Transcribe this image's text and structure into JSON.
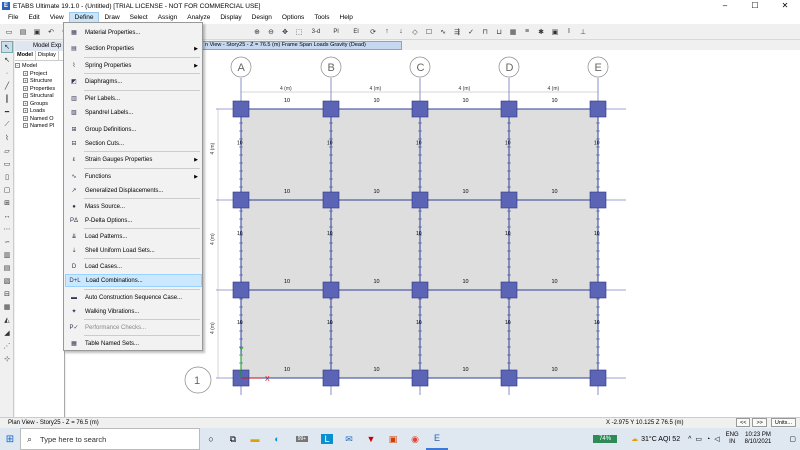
{
  "window": {
    "title": "ETABS Ultimate 19.1.0 - (Untitled)  [TRIAL LICENSE - NOT FOR COMMERCIAL USE]",
    "app_icon_letter": "E",
    "minimize": "–",
    "maximize": "☐",
    "close": "✕"
  },
  "menubar": [
    "File",
    "Edit",
    "View",
    "Define",
    "Draw",
    "Select",
    "Assign",
    "Analyze",
    "Display",
    "Design",
    "Options",
    "Tools",
    "Help"
  ],
  "active_menu": "Define",
  "toolbar": {
    "view_3d": "3-d",
    "view_plan": "Pl",
    "view_elev": "El"
  },
  "explorer": {
    "title": "Model Exp",
    "tabs": [
      "Model",
      "Display"
    ],
    "tree": [
      "Model",
      "Project",
      "Structure",
      "Properties",
      "Structural",
      "Groups",
      "Loads",
      "Named O",
      "Named Pl"
    ]
  },
  "view_tab": "n View - Story25 - Z = 76.5 (m)  Frame Span Loads Gravity (Dead)",
  "define_menu": [
    {
      "label": "Material Properties...",
      "icon": "material-icon",
      "glyph": "▦",
      "submenu": false,
      "enabled": true
    },
    {
      "label": "Section Properties",
      "icon": "section-icon",
      "glyph": "▤",
      "submenu": true,
      "enabled": true
    },
    {
      "label": "Spring Properties",
      "icon": "spring-icon",
      "glyph": "⌇",
      "submenu": true,
      "enabled": true
    },
    {
      "label": "Diaphragms...",
      "icon": "diaphragm-icon",
      "glyph": "◩",
      "submenu": false,
      "enabled": true
    },
    {
      "label": "Pier Labels...",
      "icon": "pier-icon",
      "glyph": "▥",
      "submenu": false,
      "enabled": true
    },
    {
      "label": "Spandrel Labels...",
      "icon": "spandrel-icon",
      "glyph": "▧",
      "submenu": false,
      "enabled": true
    },
    {
      "label": "Group Definitions...",
      "icon": "group-icon",
      "glyph": "⊞",
      "submenu": false,
      "enabled": true
    },
    {
      "label": "Section Cuts...",
      "icon": "section-cut-icon",
      "glyph": "⊟",
      "submenu": false,
      "enabled": true
    },
    {
      "label": "Strain Gauges Properties",
      "icon": "strain-gauge-icon",
      "glyph": "ε",
      "submenu": true,
      "enabled": true
    },
    {
      "label": "Functions",
      "icon": "function-icon",
      "glyph": "∿",
      "submenu": true,
      "enabled": true
    },
    {
      "label": "Generalized Displacements...",
      "icon": "displacement-icon",
      "glyph": "↗",
      "submenu": false,
      "enabled": true
    },
    {
      "label": "Mass Source...",
      "icon": "mass-icon",
      "glyph": "●",
      "submenu": false,
      "enabled": true
    },
    {
      "label": "P-Delta Options...",
      "icon": "pdelta-icon",
      "glyph": "PΔ",
      "submenu": false,
      "enabled": true
    },
    {
      "label": "Load Patterns...",
      "icon": "load-pattern-icon",
      "glyph": "⇊",
      "submenu": false,
      "enabled": true
    },
    {
      "label": "Shell Uniform Load Sets...",
      "icon": "shell-load-icon",
      "glyph": "⇣",
      "submenu": false,
      "enabled": true
    },
    {
      "label": "Load Cases...",
      "icon": "load-case-icon",
      "glyph": "D",
      "submenu": false,
      "enabled": true
    },
    {
      "label": "Load Combinations...",
      "icon": "load-combo-icon",
      "glyph": "D+L",
      "submenu": false,
      "enabled": true
    },
    {
      "label": "Auto Construction Sequence Case...",
      "icon": "construction-icon",
      "glyph": "▬",
      "submenu": false,
      "enabled": true
    },
    {
      "label": "Walking Vibrations...",
      "icon": "walking-icon",
      "glyph": "✦",
      "submenu": false,
      "enabled": true
    },
    {
      "label": "Performance Checks...",
      "icon": "performance-icon",
      "glyph": "P✓",
      "submenu": false,
      "enabled": false
    },
    {
      "label": "Table Named Sets...",
      "icon": "table-icon",
      "glyph": "▦",
      "submenu": false,
      "enabled": true
    }
  ],
  "highlighted_item": "Load Combinations...",
  "plan": {
    "grid_columns": [
      "A",
      "B",
      "C",
      "D",
      "E"
    ],
    "grid_rows": [
      "1"
    ],
    "bay_dimension": "4 (m)",
    "beam_load": "10",
    "axis_x": "X",
    "axis_y": "Y"
  },
  "status": {
    "left": "Plan View - Story25 - Z = 76.5 (m)",
    "coords": "X -2.975  Y 10.125  Z 76.5 (m)",
    "buttons": [
      "<<",
      ">>",
      "Units..."
    ]
  },
  "taskbar": {
    "search_placeholder": "Type here to search",
    "battery": "74%",
    "weather": "31°C  AQI 52",
    "lang_line1": "ENG",
    "lang_line2": "IN",
    "time": "10:23 PM",
    "date": "8/10/2021",
    "badge": "99+"
  },
  "colors": {
    "column_fill": "#5b64b5",
    "grid_line": "#3a49a8",
    "slab": "#dedede",
    "menu_highlight": "#cce8ff"
  }
}
